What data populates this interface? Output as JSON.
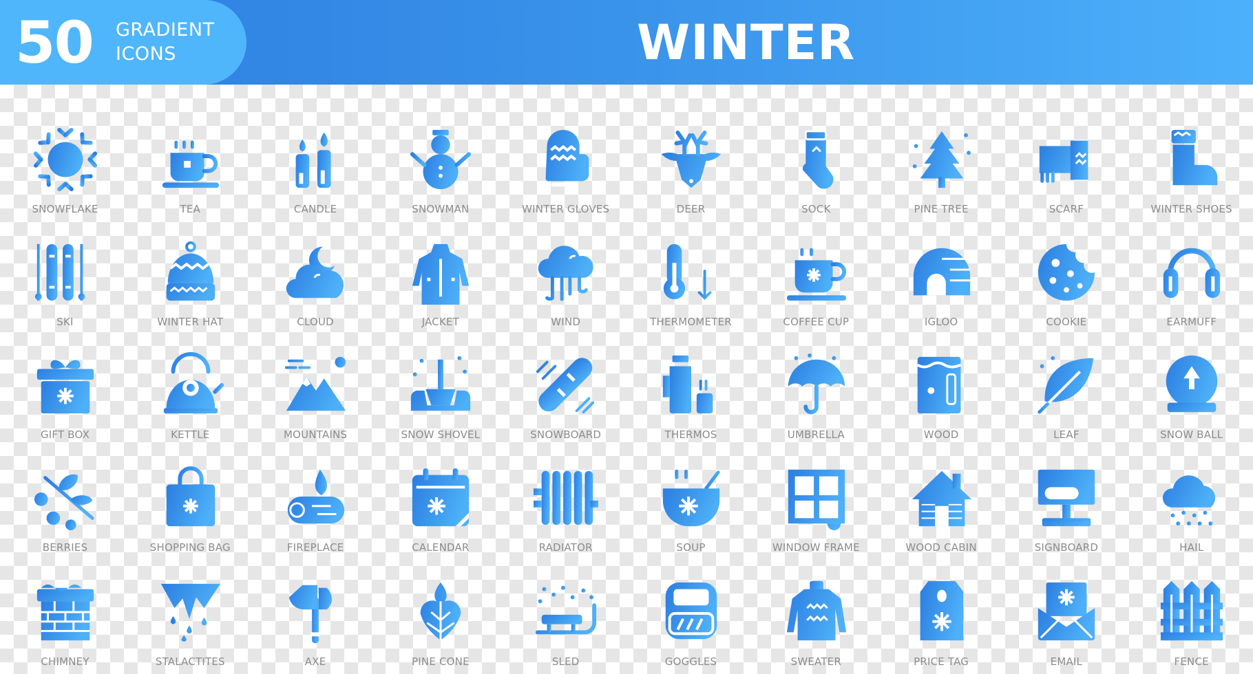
{
  "header": {
    "count": "50",
    "badge_line1": "GRADIENT",
    "badge_line2": "ICONS",
    "title": "WINTER"
  },
  "colors": {
    "header_left": "#2c7de0",
    "header_right": "#4cb0fb",
    "badge": "#50b6fb",
    "icon_gradient_start": "#2b7de0",
    "icon_gradient_end": "#4db0f8",
    "label": "#8c8c8c"
  },
  "icons": [
    {
      "label": "SNOWFLAKE",
      "icon": "snowflake"
    },
    {
      "label": "TEA",
      "icon": "tea"
    },
    {
      "label": "CANDLE",
      "icon": "candle"
    },
    {
      "label": "SNOWMAN",
      "icon": "snowman"
    },
    {
      "label": "WINTER GLOVES",
      "icon": "gloves"
    },
    {
      "label": "DEER",
      "icon": "deer"
    },
    {
      "label": "SOCK",
      "icon": "sock"
    },
    {
      "label": "PINE TREE",
      "icon": "pine"
    },
    {
      "label": "SCARF",
      "icon": "scarf"
    },
    {
      "label": "WINTER SHOES",
      "icon": "shoes"
    },
    {
      "label": "SKI",
      "icon": "ski"
    },
    {
      "label": "WINTER HAT",
      "icon": "hat"
    },
    {
      "label": "CLOUD",
      "icon": "cloud"
    },
    {
      "label": "JACKET",
      "icon": "jacket"
    },
    {
      "label": "WIND",
      "icon": "wind"
    },
    {
      "label": "THERMOMETER",
      "icon": "thermometer"
    },
    {
      "label": "COFFEE CUP",
      "icon": "coffee"
    },
    {
      "label": "IGLOO",
      "icon": "igloo"
    },
    {
      "label": "COOKIE",
      "icon": "cookie"
    },
    {
      "label": "EARMUFF",
      "icon": "earmuff"
    },
    {
      "label": "GIFT BOX",
      "icon": "gift"
    },
    {
      "label": "KETTLE",
      "icon": "kettle"
    },
    {
      "label": "MOUNTAINS",
      "icon": "mountains"
    },
    {
      "label": "SNOW SHOVEL",
      "icon": "shovel"
    },
    {
      "label": "SNOWBOARD",
      "icon": "snowboard"
    },
    {
      "label": "THERMOS",
      "icon": "thermos"
    },
    {
      "label": "UMBRELLA",
      "icon": "umbrella"
    },
    {
      "label": "WOOD",
      "icon": "wood"
    },
    {
      "label": "LEAF",
      "icon": "leaf"
    },
    {
      "label": "SNOW BALL",
      "icon": "snowball"
    },
    {
      "label": "BERRIES",
      "icon": "berries"
    },
    {
      "label": "SHOPPING BAG",
      "icon": "bag"
    },
    {
      "label": "FIREPLACE",
      "icon": "fireplace"
    },
    {
      "label": "CALENDAR",
      "icon": "calendar"
    },
    {
      "label": "RADIATOR",
      "icon": "radiator"
    },
    {
      "label": "SOUP",
      "icon": "soup"
    },
    {
      "label": "WINDOW FRAME",
      "icon": "window"
    },
    {
      "label": "WOOD CABIN",
      "icon": "cabin"
    },
    {
      "label": "SIGNBOARD",
      "icon": "signboard"
    },
    {
      "label": "HAIL",
      "icon": "hail"
    },
    {
      "label": "CHIMNEY",
      "icon": "chimney"
    },
    {
      "label": "STALACTITES",
      "icon": "stalactites"
    },
    {
      "label": "AXE",
      "icon": "axe"
    },
    {
      "label": "PINE CONE",
      "icon": "pinecone"
    },
    {
      "label": "SLED",
      "icon": "sled"
    },
    {
      "label": "GOGGLES",
      "icon": "goggles"
    },
    {
      "label": "SWEATER",
      "icon": "sweater"
    },
    {
      "label": "PRICE TAG",
      "icon": "pricetag"
    },
    {
      "label": "EMAIL",
      "icon": "email"
    },
    {
      "label": "FENCE",
      "icon": "fence"
    }
  ]
}
